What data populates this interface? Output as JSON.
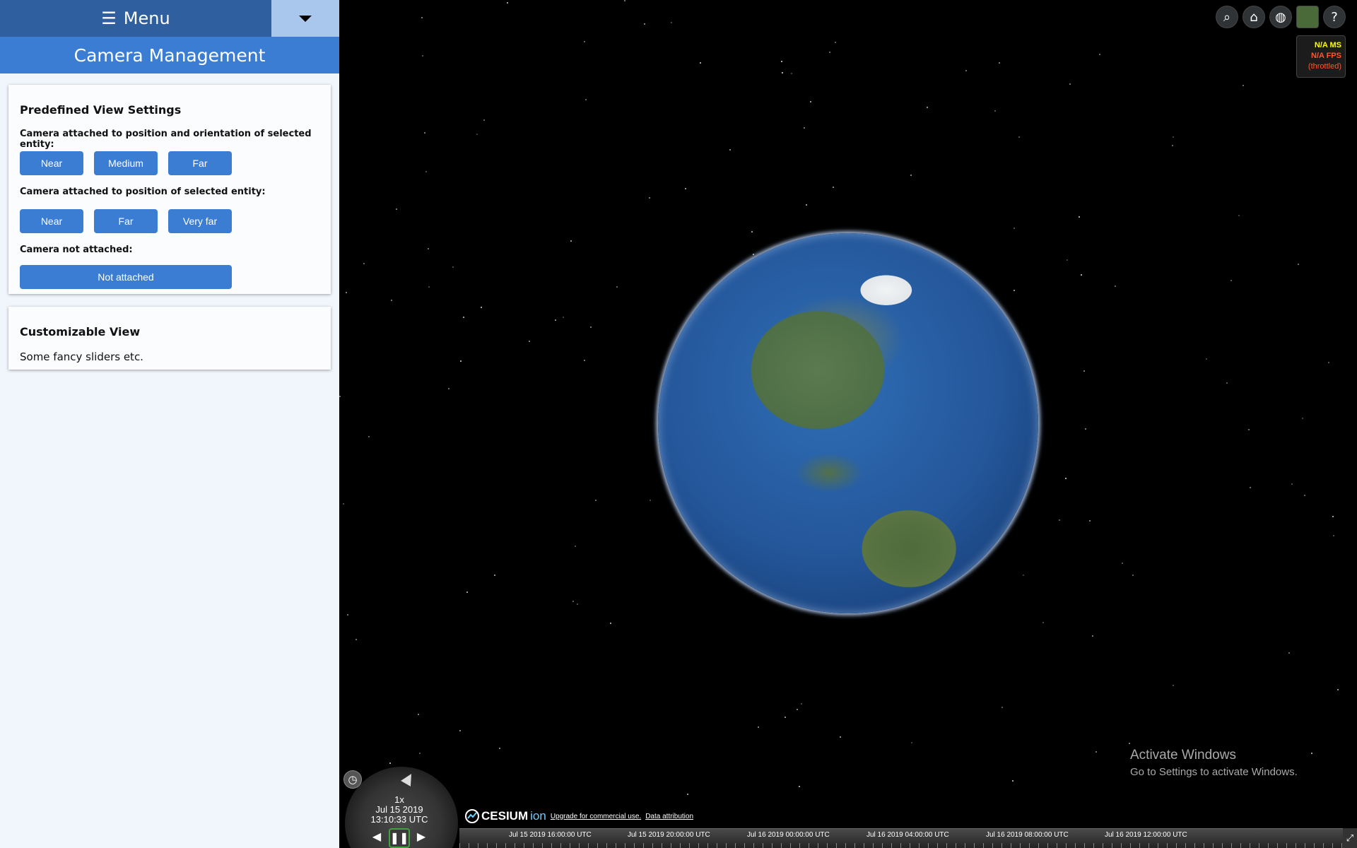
{
  "menu": {
    "title": "Menu",
    "burger": "☰"
  },
  "section_header": "Camera Management",
  "predefined": {
    "title": "Predefined View Settings",
    "group1_label": "Camera attached to position and orientation of selected entity:",
    "group1_buttons": [
      "Near",
      "Medium",
      "Far"
    ],
    "group2_label": "Camera attached to position of selected entity:",
    "group2_buttons": [
      "Near",
      "Far",
      "Very far"
    ],
    "group3_label": "Camera not attached:",
    "group3_button": "Not attached"
  },
  "custom": {
    "title": "Customizable View",
    "description": "Some fancy sliders etc."
  },
  "toolbar": {
    "icons": [
      "search-icon",
      "home-icon",
      "globe-icon",
      "imagery-layer-icon",
      "help-icon"
    ],
    "search_glyph": "⌕",
    "home_glyph": "⌂",
    "globe_glyph": "◍",
    "help_glyph": "?"
  },
  "performance": {
    "ms": "N/A MS",
    "fps": "N/A FPS",
    "status": "(throttled)"
  },
  "watermark": {
    "title": "Activate Windows",
    "subtitle": "Go to Settings to activate Windows."
  },
  "animation": {
    "speed": "1x",
    "date": "Jul 15 2019",
    "time": "13:10:33 UTC",
    "clock_glyph": "◷",
    "back_glyph": "◀",
    "pause_glyph": "❚❚",
    "forward_glyph": "▶"
  },
  "credits": {
    "logo_text": "CESIUM",
    "logo_ion": "ion",
    "upgrade": "Upgrade for commercial use.",
    "attribution": "Data attribution"
  },
  "timeline": {
    "labels": [
      "Jul 15 2019 16:00:00 UTC",
      "Jul 15 2019 20:00:00 UTC",
      "Jul 16 2019 00:00:00 UTC",
      "Jul 16 2019 04:00:00 UTC",
      "Jul 16 2019 08:00:00 UTC",
      "Jul 16 2019 12:00:00 UTC"
    ]
  },
  "colors": {
    "menu_dark": "#2f5f9e",
    "accent": "#3a7dd3",
    "dropdown": "#a9c6ec",
    "panel_bg": "#f1f6fc"
  }
}
